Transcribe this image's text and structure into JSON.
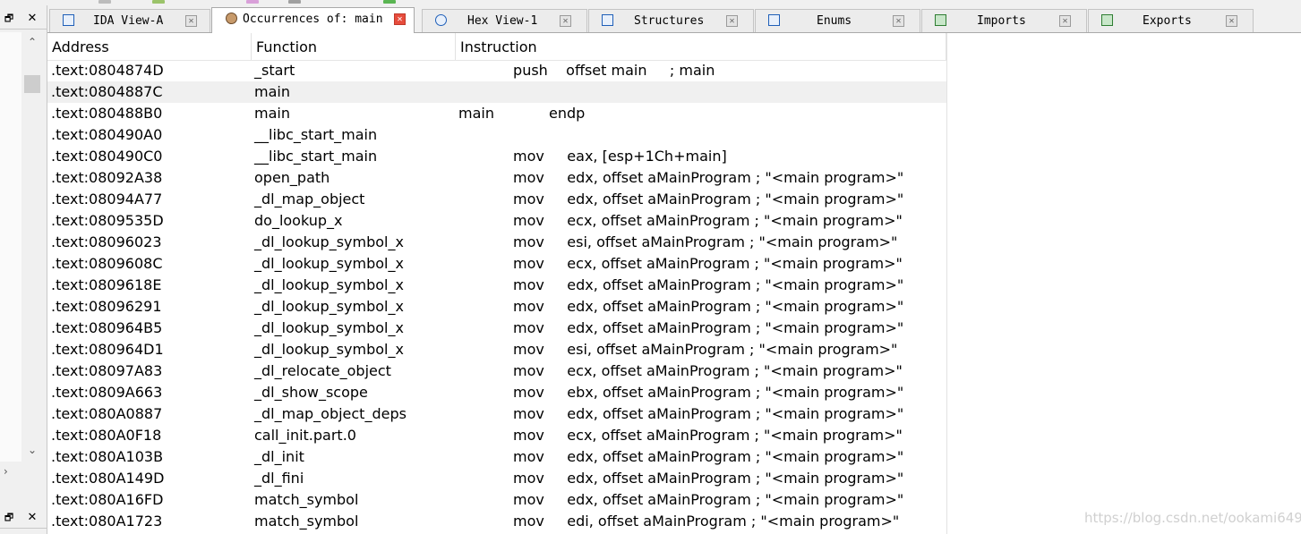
{
  "side_panel": {
    "restore_glyph": "🗗",
    "close_glyph": "✕",
    "scroll_up_glyph": "⌃",
    "scroll_down_glyph": "⌄",
    "scroll_right_glyph": "›"
  },
  "tabs": [
    {
      "label": "IDA View-A",
      "icon": "ida-view-icon",
      "active": false
    },
    {
      "label": "Occurrences of: main",
      "icon": "occurrences-icon",
      "active": true
    },
    {
      "label": "Hex View-1",
      "icon": "hex-view-icon",
      "active": false
    },
    {
      "label": "Structures",
      "icon": "structures-icon",
      "active": false
    },
    {
      "label": "Enums",
      "icon": "enums-icon",
      "active": false
    },
    {
      "label": "Imports",
      "icon": "imports-icon",
      "active": false
    },
    {
      "label": "Exports",
      "icon": "exports-icon",
      "active": false
    }
  ],
  "columns": {
    "address": "Address",
    "function": "Function",
    "instruction": "Instruction"
  },
  "rows": [
    {
      "address": ".text:0804874D",
      "function": "_start",
      "instruction": "            push    offset main     ; main"
    },
    {
      "address": ".text:0804887C",
      "function": "main",
      "instruction": "",
      "selected": true
    },
    {
      "address": ".text:080488B0",
      "function": "main",
      "instruction": "main            endp"
    },
    {
      "address": ".text:080490A0",
      "function": "__libc_start_main",
      "instruction": ""
    },
    {
      "address": ".text:080490C0",
      "function": "__libc_start_main",
      "instruction": "            mov     eax, [esp+1Ch+main]"
    },
    {
      "address": ".text:08092A38",
      "function": "open_path",
      "instruction": "            mov     edx, offset aMainProgram ; \"<main program>\""
    },
    {
      "address": ".text:08094A77",
      "function": "_dl_map_object",
      "instruction": "            mov     edx, offset aMainProgram ; \"<main program>\""
    },
    {
      "address": ".text:0809535D",
      "function": "do_lookup_x",
      "instruction": "            mov     ecx, offset aMainProgram ; \"<main program>\""
    },
    {
      "address": ".text:08096023",
      "function": "_dl_lookup_symbol_x",
      "instruction": "            mov     esi, offset aMainProgram ; \"<main program>\""
    },
    {
      "address": ".text:0809608C",
      "function": "_dl_lookup_symbol_x",
      "instruction": "            mov     ecx, offset aMainProgram ; \"<main program>\""
    },
    {
      "address": ".text:0809618E",
      "function": "_dl_lookup_symbol_x",
      "instruction": "            mov     edx, offset aMainProgram ; \"<main program>\""
    },
    {
      "address": ".text:08096291",
      "function": "_dl_lookup_symbol_x",
      "instruction": "            mov     edx, offset aMainProgram ; \"<main program>\""
    },
    {
      "address": ".text:080964B5",
      "function": "_dl_lookup_symbol_x",
      "instruction": "            mov     edx, offset aMainProgram ; \"<main program>\""
    },
    {
      "address": ".text:080964D1",
      "function": "_dl_lookup_symbol_x",
      "instruction": "            mov     esi, offset aMainProgram ; \"<main program>\""
    },
    {
      "address": ".text:08097A83",
      "function": "_dl_relocate_object",
      "instruction": "            mov     ecx, offset aMainProgram ; \"<main program>\""
    },
    {
      "address": ".text:0809A663",
      "function": "_dl_show_scope",
      "instruction": "            mov     ebx, offset aMainProgram ; \"<main program>\""
    },
    {
      "address": ".text:080A0887",
      "function": "_dl_map_object_deps",
      "instruction": "            mov     edx, offset aMainProgram ; \"<main program>\""
    },
    {
      "address": ".text:080A0F18",
      "function": "call_init.part.0",
      "instruction": "            mov     ecx, offset aMainProgram ; \"<main program>\""
    },
    {
      "address": ".text:080A103B",
      "function": "_dl_init",
      "instruction": "            mov     edx, offset aMainProgram ; \"<main program>\""
    },
    {
      "address": ".text:080A149D",
      "function": "_dl_fini",
      "instruction": "            mov     edx, offset aMainProgram ; \"<main program>\""
    },
    {
      "address": ".text:080A16FD",
      "function": "match_symbol",
      "instruction": "            mov     edx, offset aMainProgram ; \"<main program>\""
    },
    {
      "address": ".text:080A1723",
      "function": "match_symbol",
      "instruction": "            mov     edi, offset aMainProgram ; \"<main program>\""
    }
  ],
  "watermark": "https://blog.csdn.net/ookami6497",
  "colors": {
    "selected_row": "#f0f0f0",
    "active_tab_close": "#e74c3c"
  }
}
